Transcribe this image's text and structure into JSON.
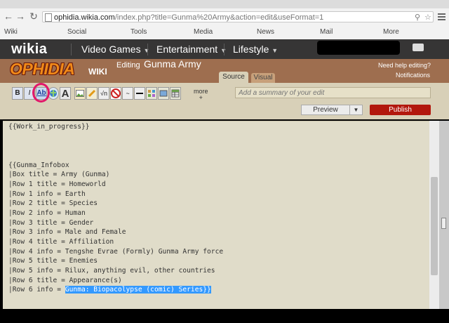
{
  "browser": {
    "url_host": "ophidia.wikia.com",
    "url_path": "/index.php?title=Gunma%20Army&action=edit&useFormat=1"
  },
  "bookmarks": [
    "Wiki",
    "Social",
    "Tools",
    "Media",
    "News",
    "Mail",
    "More"
  ],
  "wikia_bar": {
    "logo": "wikia",
    "nav": [
      "Video Games",
      "Entertainment",
      "Lifestyle"
    ],
    "caret": "▼"
  },
  "wiki": {
    "wordmark": "OPHIDIA",
    "wordmark_sub": "WIKI",
    "editing_label": "Editing",
    "page_title": "Gunma Army",
    "need_help": "Need help editing?",
    "notifications": "Notifications"
  },
  "editor": {
    "tabs": {
      "source": "Source",
      "visual": "Visual"
    },
    "toolbar": {
      "bold": "B",
      "italic": "I",
      "internal_link": "Ab",
      "big_a": "A",
      "more": "more",
      "more_plus": "+"
    },
    "summary_placeholder": "Add a summary of your edit",
    "preview_label": "Preview",
    "preview_dropdown": "▼",
    "publish_label": "Publish",
    "lines": [
      "{{Work_in_progress}}",
      "",
      "",
      "",
      "{{Gunma_Infobox",
      "|Box title = Army (Gunma)",
      "|Row 1 title = Homeworld",
      "|Row 1 info = Earth",
      "|Row 2 title = Species",
      "|Row 2 info = Human",
      "|Row 3 title = Gender",
      "|Row 3 info = Male and Female",
      "|Row 4 title = Affiliation",
      "|Row 4 info = Tengshe Evrae (Formly) Gunma Army force",
      "|Row 5 title = Enemies",
      "|Row 5 info = Rilux, anything evil, other countries",
      "|Row 6 title = Appearance(s)"
    ],
    "last_line_prefix": "|Row 6 info = ",
    "last_line_selected": "Gunma: Biopacolypse (comic) Series}}"
  },
  "colors": {
    "wikia_bar": "#363535",
    "header_brown": "#9e6e4f",
    "toolbar_bg": "#d8d0b8",
    "edit_bg": "#e0dcc9",
    "publish_red": "#b2170d",
    "highlight_circle": "#e2186a",
    "selection_blue": "#3399ff"
  }
}
